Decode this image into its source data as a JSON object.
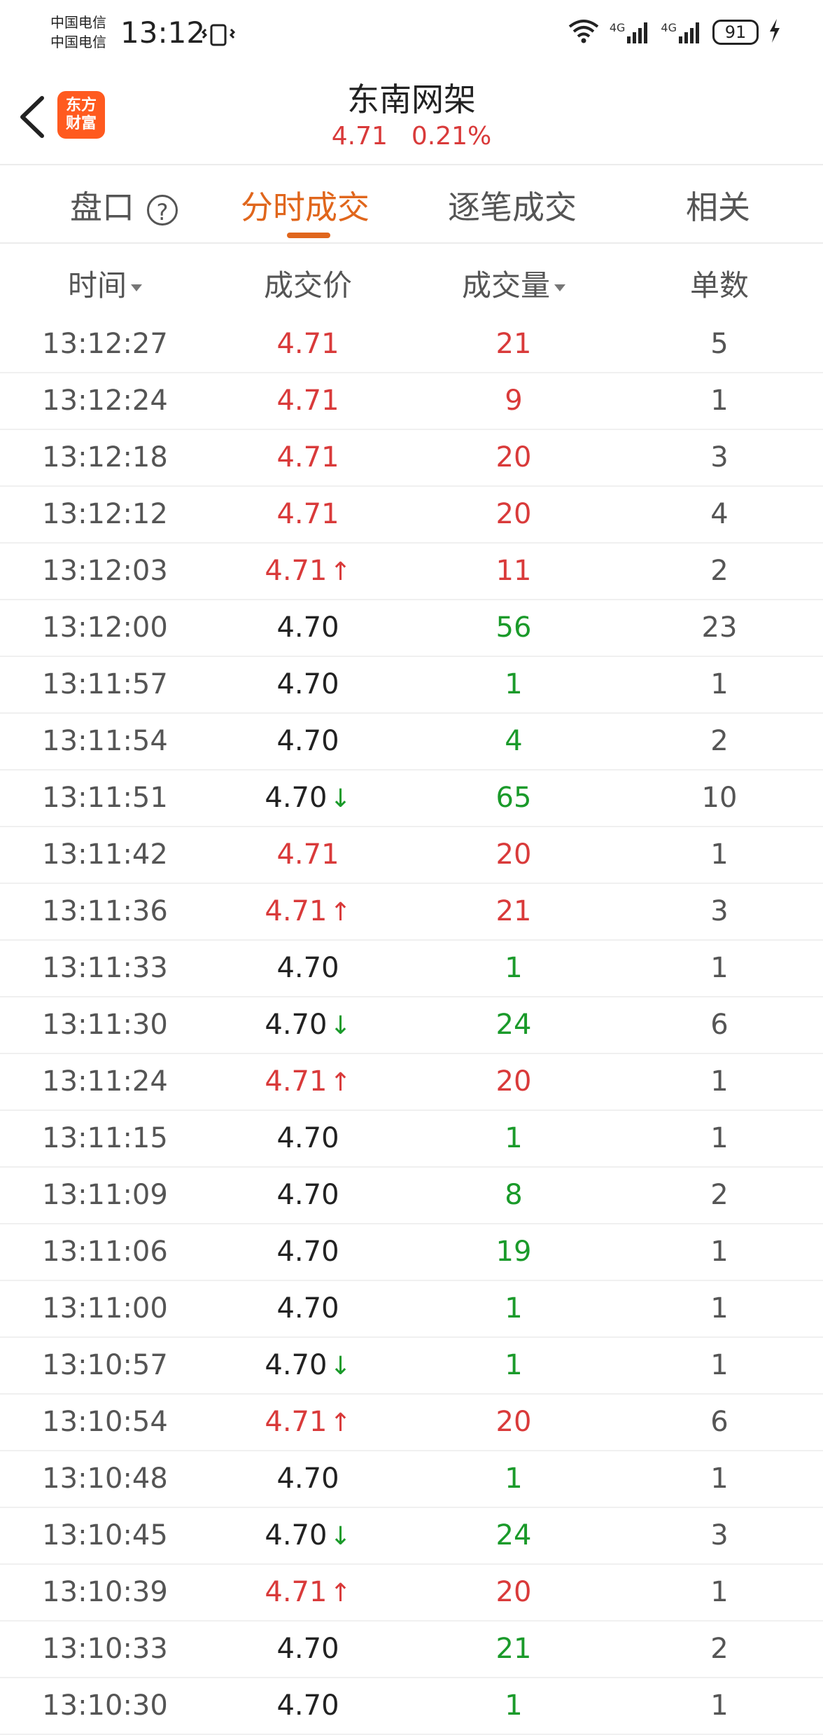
{
  "status_bar": {
    "carrier1": "中国电信",
    "carrier2": "中国电信",
    "time": "13:12",
    "network1": "4G",
    "network2": "4G",
    "battery": "91"
  },
  "header": {
    "logo_line1": "东方",
    "logo_line2": "财富",
    "stock_name": "东南网架",
    "price": "4.71",
    "change_pct": "0.21%"
  },
  "tabs": [
    {
      "label": "盘口"
    },
    {
      "label": "分时成交"
    },
    {
      "label": "逐笔成交"
    },
    {
      "label": "相关"
    }
  ],
  "columns": {
    "time": "时间",
    "price": "成交价",
    "volume": "成交量",
    "count": "单数"
  },
  "colors": {
    "up": "#d93a3a",
    "down": "#1a9a2a",
    "accent": "#e0661c"
  },
  "trades": [
    {
      "time": "13:12:27",
      "price": "4.71",
      "pcolor": "red",
      "arrow": "",
      "vol": "21",
      "vcolor": "red",
      "count": "5"
    },
    {
      "time": "13:12:24",
      "price": "4.71",
      "pcolor": "red",
      "arrow": "",
      "vol": "9",
      "vcolor": "red",
      "count": "1"
    },
    {
      "time": "13:12:18",
      "price": "4.71",
      "pcolor": "red",
      "arrow": "",
      "vol": "20",
      "vcolor": "red",
      "count": "3"
    },
    {
      "time": "13:12:12",
      "price": "4.71",
      "pcolor": "red",
      "arrow": "",
      "vol": "20",
      "vcolor": "red",
      "count": "4"
    },
    {
      "time": "13:12:03",
      "price": "4.71",
      "pcolor": "red",
      "arrow": "up",
      "vol": "11",
      "vcolor": "red",
      "count": "2"
    },
    {
      "time": "13:12:00",
      "price": "4.70",
      "pcolor": "black",
      "arrow": "",
      "vol": "56",
      "vcolor": "green",
      "count": "23"
    },
    {
      "time": "13:11:57",
      "price": "4.70",
      "pcolor": "black",
      "arrow": "",
      "vol": "1",
      "vcolor": "green",
      "count": "1"
    },
    {
      "time": "13:11:54",
      "price": "4.70",
      "pcolor": "black",
      "arrow": "",
      "vol": "4",
      "vcolor": "green",
      "count": "2"
    },
    {
      "time": "13:11:51",
      "price": "4.70",
      "pcolor": "black",
      "arrow": "down",
      "vol": "65",
      "vcolor": "green",
      "count": "10"
    },
    {
      "time": "13:11:42",
      "price": "4.71",
      "pcolor": "red",
      "arrow": "",
      "vol": "20",
      "vcolor": "red",
      "count": "1"
    },
    {
      "time": "13:11:36",
      "price": "4.71",
      "pcolor": "red",
      "arrow": "up",
      "vol": "21",
      "vcolor": "red",
      "count": "3"
    },
    {
      "time": "13:11:33",
      "price": "4.70",
      "pcolor": "black",
      "arrow": "",
      "vol": "1",
      "vcolor": "green",
      "count": "1"
    },
    {
      "time": "13:11:30",
      "price": "4.70",
      "pcolor": "black",
      "arrow": "down",
      "vol": "24",
      "vcolor": "green",
      "count": "6"
    },
    {
      "time": "13:11:24",
      "price": "4.71",
      "pcolor": "red",
      "arrow": "up",
      "vol": "20",
      "vcolor": "red",
      "count": "1"
    },
    {
      "time": "13:11:15",
      "price": "4.70",
      "pcolor": "black",
      "arrow": "",
      "vol": "1",
      "vcolor": "green",
      "count": "1"
    },
    {
      "time": "13:11:09",
      "price": "4.70",
      "pcolor": "black",
      "arrow": "",
      "vol": "8",
      "vcolor": "green",
      "count": "2"
    },
    {
      "time": "13:11:06",
      "price": "4.70",
      "pcolor": "black",
      "arrow": "",
      "vol": "19",
      "vcolor": "green",
      "count": "1"
    },
    {
      "time": "13:11:00",
      "price": "4.70",
      "pcolor": "black",
      "arrow": "",
      "vol": "1",
      "vcolor": "green",
      "count": "1"
    },
    {
      "time": "13:10:57",
      "price": "4.70",
      "pcolor": "black",
      "arrow": "down",
      "vol": "1",
      "vcolor": "green",
      "count": "1"
    },
    {
      "time": "13:10:54",
      "price": "4.71",
      "pcolor": "red",
      "arrow": "up",
      "vol": "20",
      "vcolor": "red",
      "count": "6"
    },
    {
      "time": "13:10:48",
      "price": "4.70",
      "pcolor": "black",
      "arrow": "",
      "vol": "1",
      "vcolor": "green",
      "count": "1"
    },
    {
      "time": "13:10:45",
      "price": "4.70",
      "pcolor": "black",
      "arrow": "down",
      "vol": "24",
      "vcolor": "green",
      "count": "3"
    },
    {
      "time": "13:10:39",
      "price": "4.71",
      "pcolor": "red",
      "arrow": "up",
      "vol": "20",
      "vcolor": "red",
      "count": "1"
    },
    {
      "time": "13:10:33",
      "price": "4.70",
      "pcolor": "black",
      "arrow": "",
      "vol": "21",
      "vcolor": "green",
      "count": "2"
    },
    {
      "time": "13:10:30",
      "price": "4.70",
      "pcolor": "black",
      "arrow": "",
      "vol": "1",
      "vcolor": "green",
      "count": "1"
    }
  ]
}
